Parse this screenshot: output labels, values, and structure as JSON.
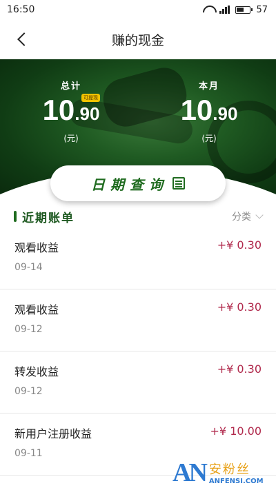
{
  "status_bar": {
    "time": "16:50",
    "signal_text": "4G\nill",
    "battery": "57"
  },
  "nav": {
    "title": "赚的现金"
  },
  "summary": {
    "total": {
      "label": "总计",
      "value_int": "10",
      "value_dec": ".90",
      "unit": "(元)",
      "badge": "可提现"
    },
    "month": {
      "label": "本月",
      "value_int": "10",
      "value_dec": ".90",
      "unit": "(元)"
    }
  },
  "date_query": {
    "label": "日期查询"
  },
  "section": {
    "title": "近期账单",
    "filter_label": "分类"
  },
  "bills": [
    {
      "title": "观看收益",
      "date": "09-14",
      "amount": "+¥ 0.30"
    },
    {
      "title": "观看收益",
      "date": "09-12",
      "amount": "+¥ 0.30"
    },
    {
      "title": "转发收益",
      "date": "09-12",
      "amount": "+¥ 0.30"
    },
    {
      "title": "新用户注册收益",
      "date": "09-11",
      "amount": "+¥ 10.00"
    }
  ],
  "watermark": {
    "logo": "AN",
    "cn": "安粉丝",
    "en": "ANFENSI.COM"
  },
  "colors": {
    "accent": "#1f6b1f",
    "amount": "#b0284b"
  }
}
